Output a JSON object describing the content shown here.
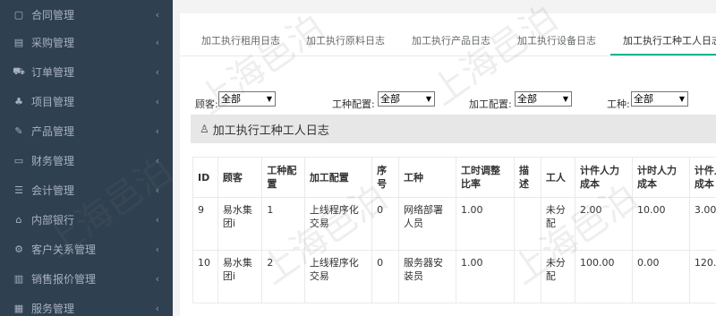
{
  "sidebar": {
    "items": [
      {
        "icon": "document-icon",
        "glyph": "▢",
        "label": "合同管理"
      },
      {
        "icon": "list-icon",
        "glyph": "▤",
        "label": "采购管理"
      },
      {
        "icon": "cart-icon",
        "glyph": "⛟",
        "label": "订单管理"
      },
      {
        "icon": "sitemap-icon",
        "glyph": "♣",
        "label": "项目管理"
      },
      {
        "icon": "edit-icon",
        "glyph": "✎",
        "label": "产品管理"
      },
      {
        "icon": "money-icon",
        "glyph": "▭",
        "label": "财务管理"
      },
      {
        "icon": "calculator-icon",
        "glyph": "☰",
        "label": "会计管理"
      },
      {
        "icon": "bank-icon",
        "glyph": "⌂",
        "label": "内部银行"
      },
      {
        "icon": "cogs-icon",
        "glyph": "⚙",
        "label": "客户关系管理"
      },
      {
        "icon": "bar-chart-icon",
        "glyph": "▥",
        "label": "销售报价管理"
      },
      {
        "icon": "service-icon",
        "glyph": "▦",
        "label": "服务管理"
      }
    ],
    "chevron": "‹"
  },
  "tabs": [
    {
      "label": "加工执行租用日志"
    },
    {
      "label": "加工执行原料日志"
    },
    {
      "label": "加工执行产品日志"
    },
    {
      "label": "加工执行设备日志"
    },
    {
      "label": "加工执行工种工人日志"
    }
  ],
  "filters": [
    {
      "label": "顾客:",
      "value": "全部"
    },
    {
      "label": "工种配置:",
      "value": "全部"
    },
    {
      "label": "加工配置:",
      "value": "全部"
    },
    {
      "label": "工种:",
      "value": "全部"
    }
  ],
  "section": {
    "title": "加工执行工种工人日志"
  },
  "table": {
    "columns": [
      "ID",
      "顾客",
      "工种配置",
      "加工配置",
      "序号",
      "工种",
      "工时调整比率",
      "描述",
      "工人",
      "计件人力成本",
      "计时人力成本",
      "计件人力成本"
    ],
    "rows": [
      [
        "9",
        "易水集团i",
        "1",
        "上线程序化交易",
        "0",
        "网络部署人员",
        "1.00",
        "",
        "未分配",
        "2.00",
        "10.00",
        "3.00"
      ],
      [
        "10",
        "易水集团i",
        "2",
        "上线程序化交易",
        "0",
        "服务器安装员",
        "1.00",
        "",
        "未分配",
        "100.00",
        "0.00",
        "120."
      ]
    ]
  },
  "watermark": "上海邑泊"
}
